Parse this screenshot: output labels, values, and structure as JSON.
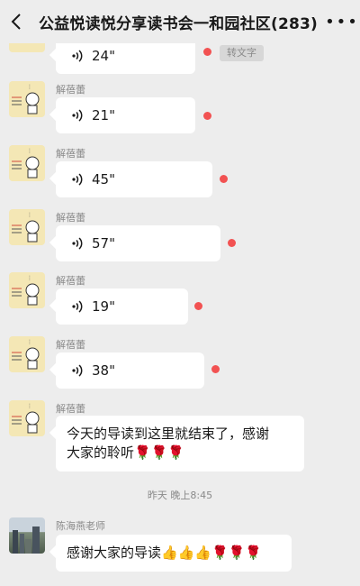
{
  "header": {
    "title": "公益悦读悦分享读书会一和园社区(283)"
  },
  "messages": [
    {
      "sender": "",
      "duration": "24\"",
      "transcribe": "转文字"
    },
    {
      "sender": "解蓓蕾",
      "duration": "21\""
    },
    {
      "sender": "解蓓蕾",
      "duration": "45\""
    },
    {
      "sender": "解蓓蕾",
      "duration": "57\""
    },
    {
      "sender": "解蓓蕾",
      "duration": "19\""
    },
    {
      "sender": "解蓓蕾",
      "duration": "38\""
    },
    {
      "sender": "解蓓蕾",
      "text_line1": "今天的导读到这里就结束了，感谢",
      "text_line2": "大家的聆听🌹🌹🌹"
    },
    {
      "sender": "陈海燕老师",
      "text": "感谢大家的导读👍👍👍🌹🌹🌹"
    }
  ],
  "timestamp": "昨天 晚上8:45",
  "colors": {
    "background": "#ededed",
    "bubble": "#ffffff",
    "unread_dot": "#f25252",
    "avatar_bg": "#f4e7b5"
  },
  "icons": [
    "back-arrow-icon",
    "more-icon",
    "voice-wave-icon"
  ]
}
